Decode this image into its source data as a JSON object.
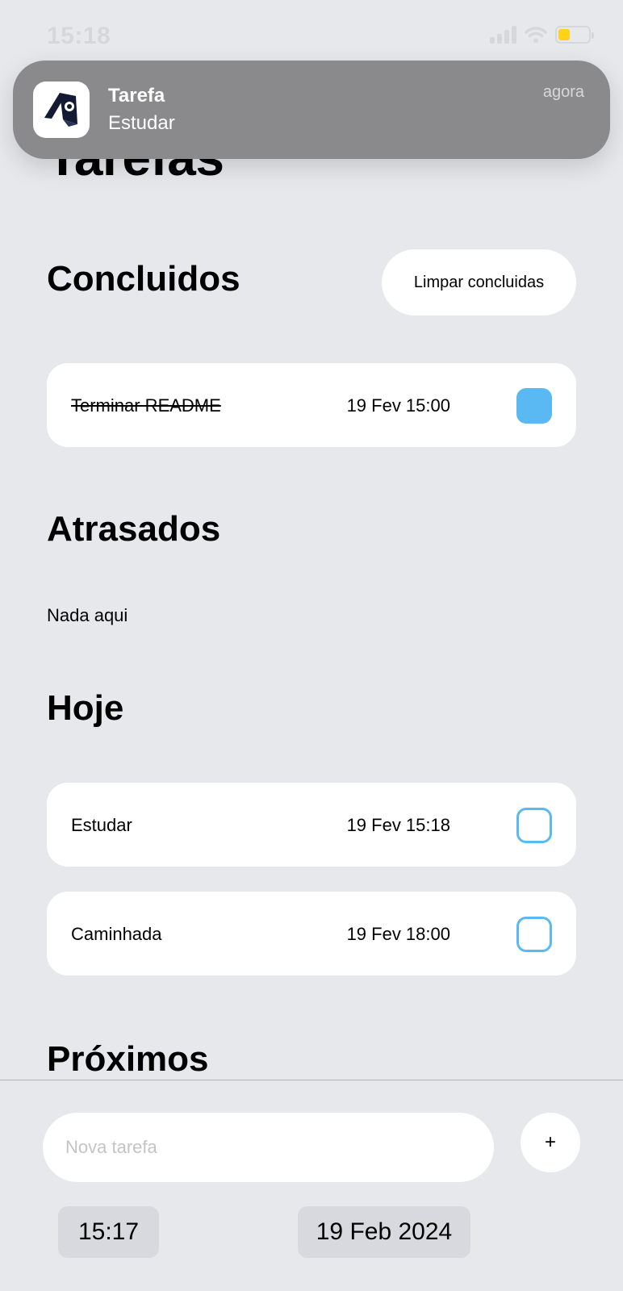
{
  "status_bar": {
    "time": "15:18"
  },
  "page": {
    "title": "Tarefas"
  },
  "notification": {
    "app_title": "Tarefa",
    "body": "Estudar",
    "time": "agora"
  },
  "sections": {
    "completed": {
      "heading": "Concluidos",
      "clear_button": "Limpar concluidas",
      "tasks": [
        {
          "name": "Terminar README",
          "date": "19 Fev 15:00",
          "done": true
        }
      ]
    },
    "overdue": {
      "heading": "Atrasados",
      "empty_text": "Nada aqui"
    },
    "today": {
      "heading": "Hoje",
      "tasks": [
        {
          "name": "Estudar",
          "date": "19 Fev 15:18",
          "done": false
        },
        {
          "name": "Caminhada",
          "date": "19 Fev 18:00",
          "done": false
        }
      ]
    },
    "upcoming": {
      "heading": "Próximos"
    }
  },
  "composer": {
    "input_placeholder": "Nova tarefa",
    "add_label": "+",
    "time": "15:17",
    "date": "19 Feb 2024"
  },
  "colors": {
    "accent": "#5ab8f2",
    "background": "#e7e8ec",
    "notification": "#8a8a8c",
    "battery": "#ffd21a"
  }
}
